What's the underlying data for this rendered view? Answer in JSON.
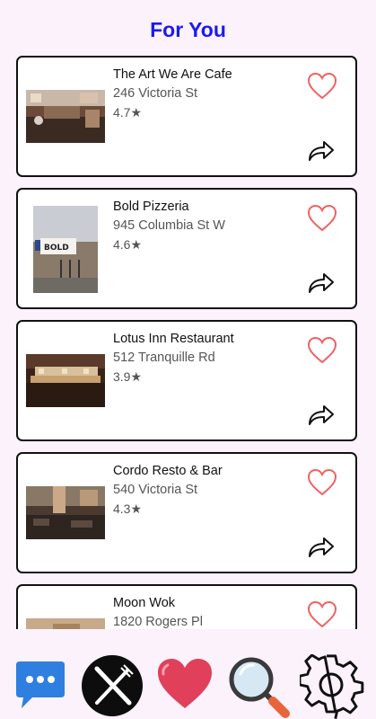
{
  "header": {
    "title": "For You"
  },
  "restaurants": [
    {
      "name": "The Art We Are Cafe",
      "address": "246 Victoria St",
      "rating": "4.7★",
      "image": "cafe-interior-photo"
    },
    {
      "name": "Bold Pizzeria",
      "address": "945 Columbia St W",
      "rating": "4.6★",
      "image": "pizzeria-storefront-photo"
    },
    {
      "name": "Lotus Inn Restaurant",
      "address": "512 Tranquille Rd",
      "rating": "3.9★",
      "image": "buffet-interior-photo"
    },
    {
      "name": "Cordo Resto & Bar",
      "address": "540 Victoria St",
      "rating": "4.3★",
      "image": "bar-interior-photo"
    },
    {
      "name": "Moon Wok",
      "address": "1820 Rogers Pl",
      "rating": "",
      "image": "restaurant-photo"
    }
  ],
  "nav": {
    "items": [
      {
        "name": "chat",
        "icon": "chat-bubble-icon"
      },
      {
        "name": "dining",
        "icon": "fork-knife-icon"
      },
      {
        "name": "favorites",
        "icon": "heart-icon"
      },
      {
        "name": "search",
        "icon": "magnifier-icon"
      },
      {
        "name": "settings",
        "icon": "gear-icon"
      }
    ]
  },
  "colors": {
    "background": "#fbf2fb",
    "title": "#1a1aee",
    "heart_outline": "#f06060",
    "nav_chat": "#2e7fe0",
    "nav_heart": "#e0405a"
  }
}
